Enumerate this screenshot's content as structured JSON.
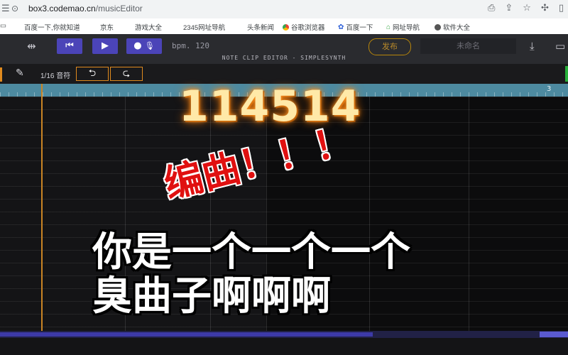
{
  "browser": {
    "url_host": "box3.codemao.cn",
    "url_path": "/musicEditor",
    "bookmarks": [
      {
        "label": "百度一下,你就知道",
        "icon": "none"
      },
      {
        "label": "京东",
        "icon": "none"
      },
      {
        "label": "游戏大全",
        "icon": "none"
      },
      {
        "label": "2345网址导航",
        "icon": "none"
      },
      {
        "label": "头条新闻",
        "icon": "none"
      },
      {
        "label": "谷歌浏览器",
        "icon": "chrome-icon"
      },
      {
        "label": "百度一下",
        "icon": "paw-icon"
      },
      {
        "label": "网址导航",
        "icon": "nav-icon"
      },
      {
        "label": "软件大全",
        "icon": "app-icon"
      }
    ]
  },
  "editor": {
    "bpm_label": "bpm.",
    "bpm_value": "120",
    "title": "NOTE CLIP EDITOR - SIMPLESYNTH",
    "publish_label": "发布",
    "project_name": "未命名",
    "quantize_label": "1/16 音符",
    "undo_symbol": "⮌",
    "redo_symbol": "⮎",
    "ruler_bar_label": "3",
    "colors": {
      "accent": "#4b44b8",
      "playhead": "#c98424",
      "ruler": "#4d8aa0"
    }
  },
  "overlay": {
    "number": "114514",
    "red_text": "编曲！！！",
    "line1": "你是一个一个一个",
    "line2": "臭曲子啊啊啊"
  }
}
